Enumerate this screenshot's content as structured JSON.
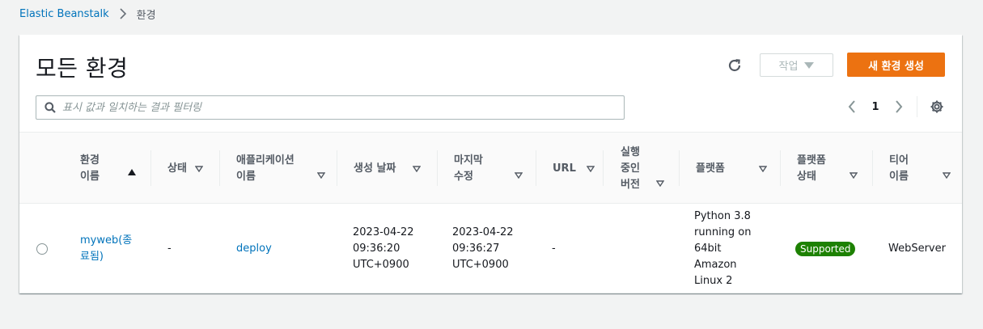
{
  "breadcrumb": {
    "root": "Elastic Beanstalk",
    "current": "환경"
  },
  "header": {
    "title": "모든 환경",
    "actions_label": "작업",
    "create_label": "새 환경 생성"
  },
  "search": {
    "placeholder": "표시 값과 일치하는 결과 필터링",
    "value": ""
  },
  "pagination": {
    "current_page": "1"
  },
  "table": {
    "columns": [
      {
        "label": "환경\n이름",
        "sort": "asc"
      },
      {
        "label": "상태",
        "sort": "none"
      },
      {
        "label": "애플리케이션\n이름",
        "sort": "none"
      },
      {
        "label": "생성 날짜",
        "sort": "none"
      },
      {
        "label": "마지막\n수정",
        "sort": "none"
      },
      {
        "label": "URL",
        "sort": "none"
      },
      {
        "label": "실행\n중인\n버전",
        "sort": "none"
      },
      {
        "label": "플랫폼",
        "sort": "none"
      },
      {
        "label": "플랫폼\n상태",
        "sort": "none"
      },
      {
        "label": "티어\n이름",
        "sort": "none"
      }
    ],
    "rows": [
      {
        "env_name": "myweb(종\n료됨)",
        "status": "-",
        "app_name": "deploy",
        "created": "2023-04-22\n09:36:20\nUTC+0900",
        "modified": "2023-04-22\n09:36:27\nUTC+0900",
        "url": "-",
        "version": "",
        "platform": "Python 3.8\nrunning on\n64bit\nAmazon\nLinux 2",
        "platform_status": "Supported",
        "tier": "WebServer"
      }
    ]
  },
  "colors": {
    "accent": "#ec7211",
    "link": "#0073bb",
    "success": "#1d8102"
  },
  "icons": {
    "breadcrumb_sep": "chevron-right-icon",
    "refresh": "refresh-icon",
    "actions_caret": "caret-down-icon",
    "search": "search-icon",
    "prev": "chevron-left-icon",
    "next": "chevron-right-icon",
    "settings": "gear-icon",
    "sort_asc": "sort-ascending-icon",
    "sort_none": "sort-caret-down-icon"
  }
}
